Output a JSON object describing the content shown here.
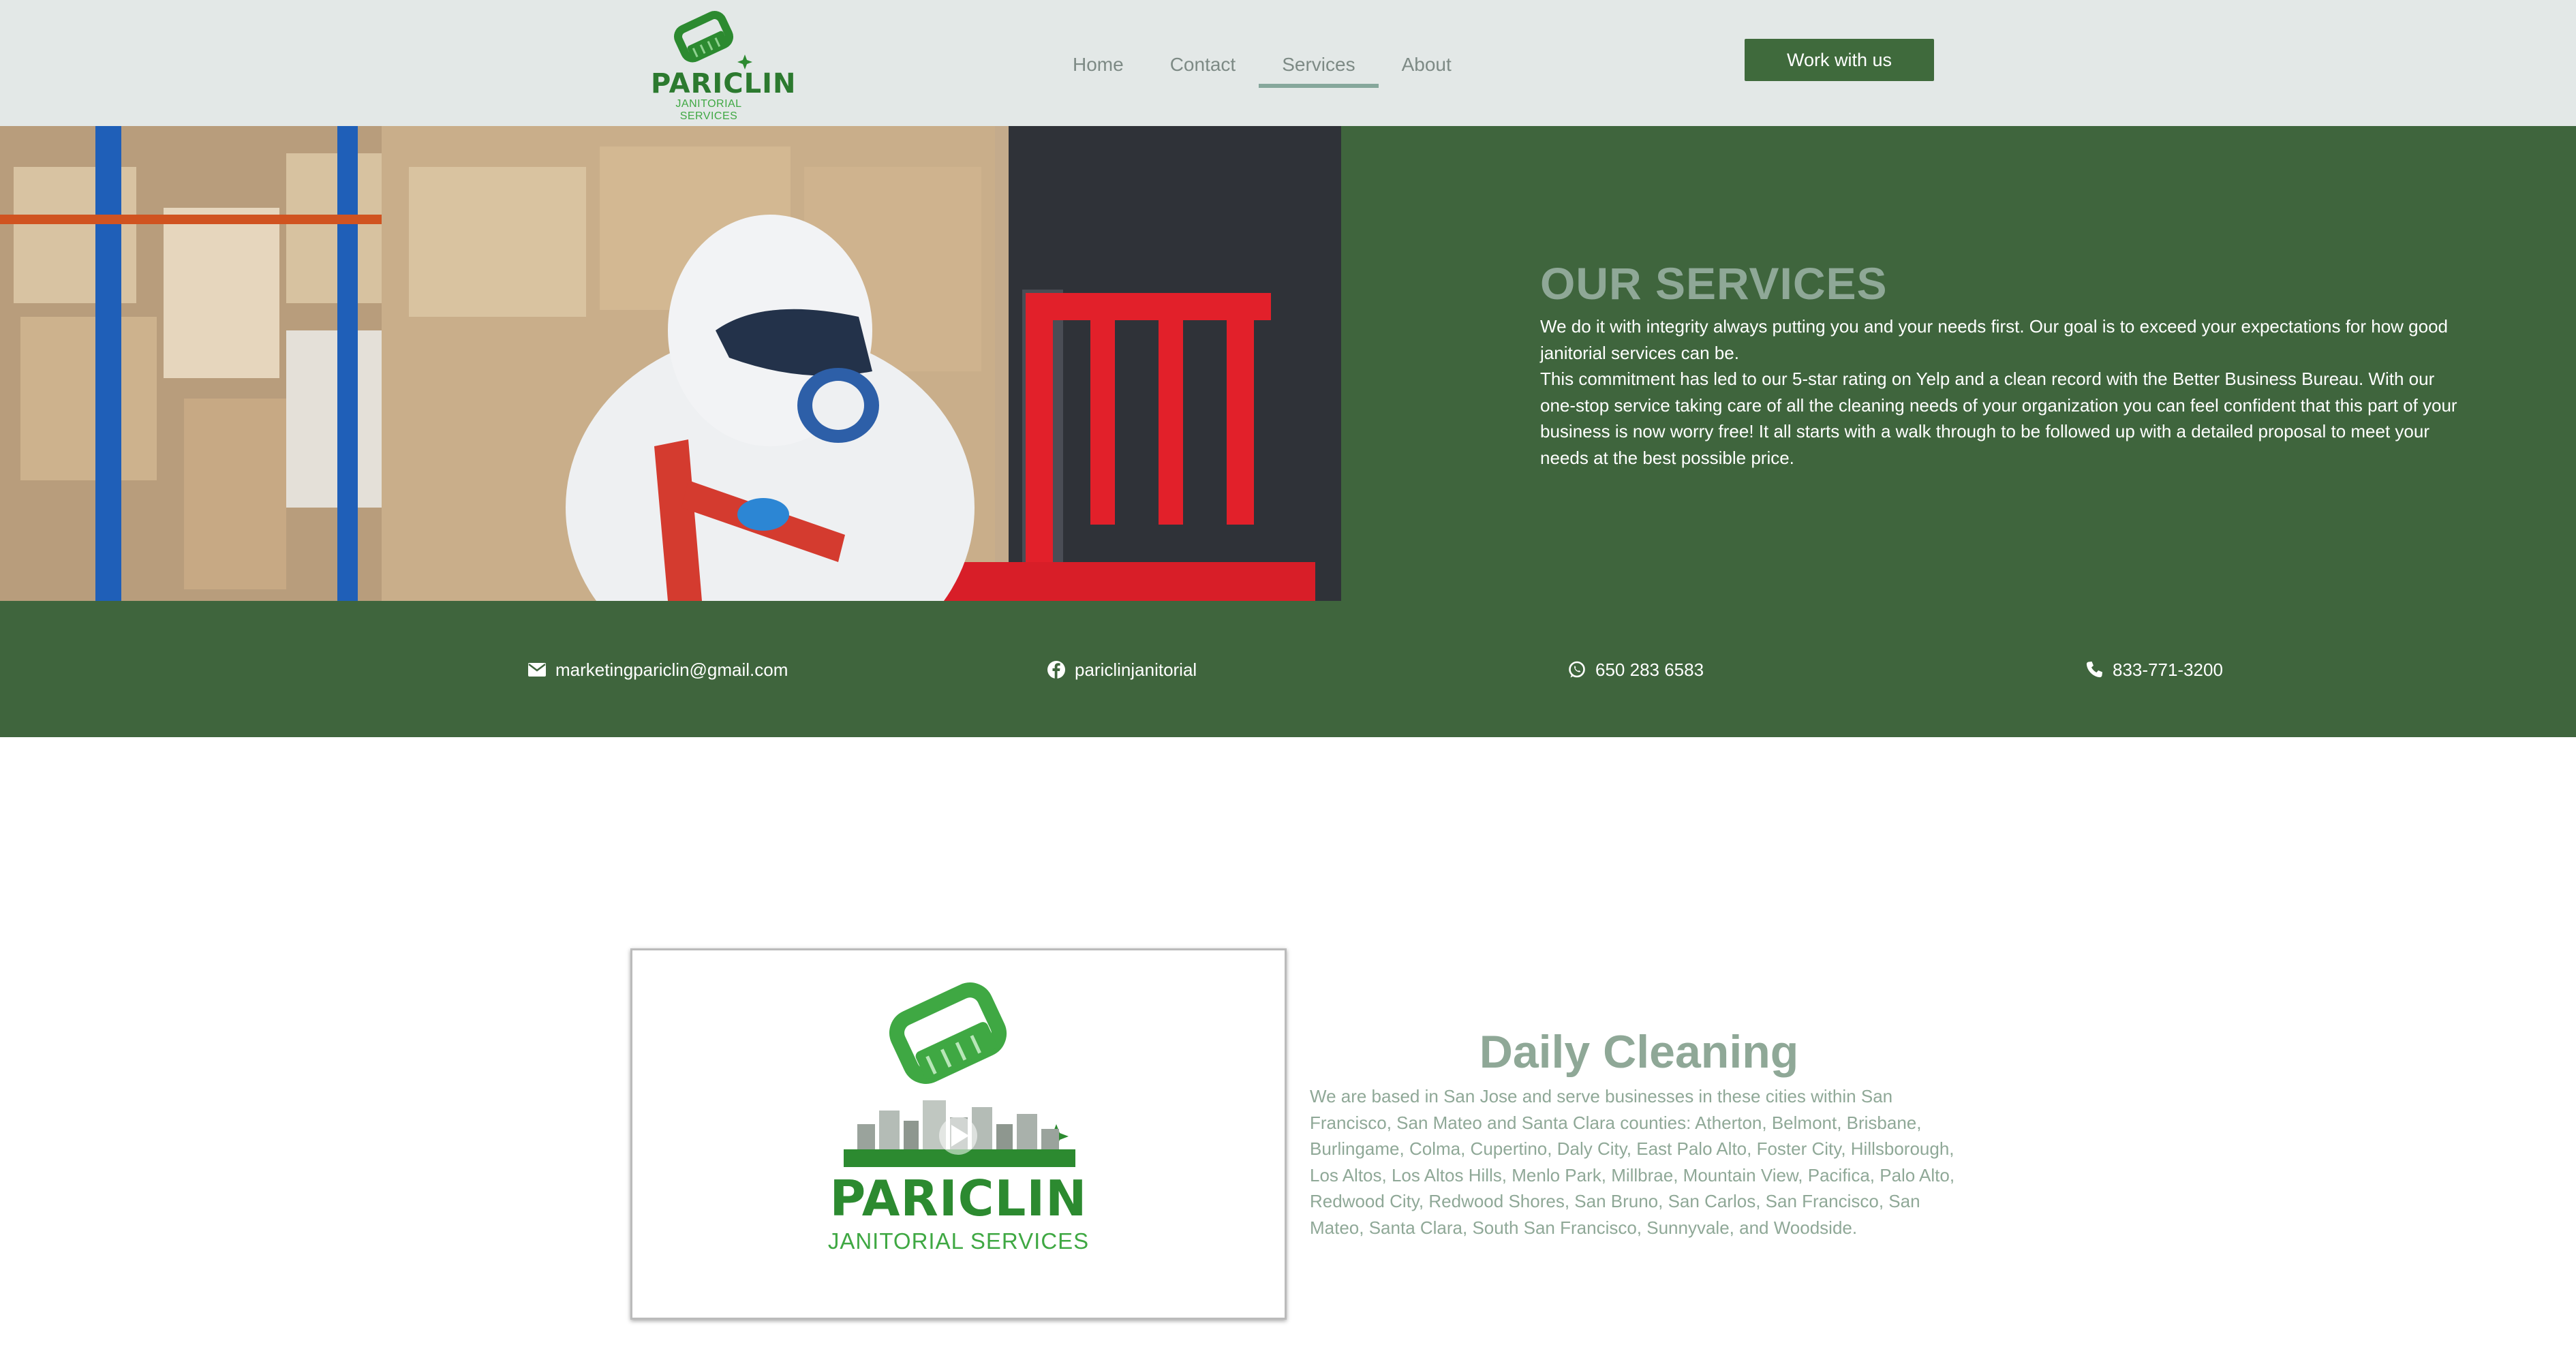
{
  "header": {
    "logo_text": "PARICLIN",
    "logo_sub": "JANITORIAL SERVICES",
    "nav": [
      {
        "label": "Home",
        "active": false
      },
      {
        "label": "Contact",
        "active": false
      },
      {
        "label": "Services",
        "active": true
      },
      {
        "label": "About",
        "active": false
      }
    ],
    "cta_label": "Work with us"
  },
  "hero": {
    "title": "OUR SERVICES",
    "paragraph1": "We do it with integrity always putting you and your needs first. Our goal is to exceed your expectations for how good janitorial services can be.",
    "paragraph2": "This commitment has led to our 5-star rating on Yelp and a clean record with the Better Business Bureau. With our one-stop service taking care of all the cleaning needs of your organization you can feel confident that this part of your business is now worry free! It all starts with a walk through to be followed up with a detailed proposal to meet your needs at the best possible price.",
    "image_alt": "worker in protective suit and respirator in warehouse"
  },
  "contact": {
    "email": "marketingpariclin@gmail.com",
    "facebook": "pariclinjanitorial",
    "whatsapp": "650 283 6583",
    "phone": "833-771-3200"
  },
  "daily": {
    "title": "Daily Cleaning",
    "text": "We are based in San Jose and serve businesses in these cities within San Francisco, San Mateo and Santa Clara counties: Atherton, Belmont, Brisbane, Burlingame, Colma, Cupertino, Daly City, East Palo Alto, Foster City, Hillsborough, Los Altos, Los Altos Hills, Menlo Park, Millbrae, Mountain View, Pacifica, Palo Alto, Redwood City, Redwood Shores, San Bruno, San Carlos, San Francisco, San Mateo, Santa Clara, South San Francisco, Sunnyvale, and Woodside.",
    "video_logo_text": "PARICLIN",
    "video_logo_sub": "JANITORIAL SERVICES"
  },
  "colors": {
    "header_bg": "#e3e8e7",
    "brand_green": "#3f653d",
    "accent_sage": "#8fa897",
    "logo_green": "#2c7a2f"
  },
  "icons": [
    "envelope-icon",
    "facebook-icon",
    "whatsapp-icon",
    "phone-icon",
    "play-icon",
    "brush-logo-icon"
  ]
}
